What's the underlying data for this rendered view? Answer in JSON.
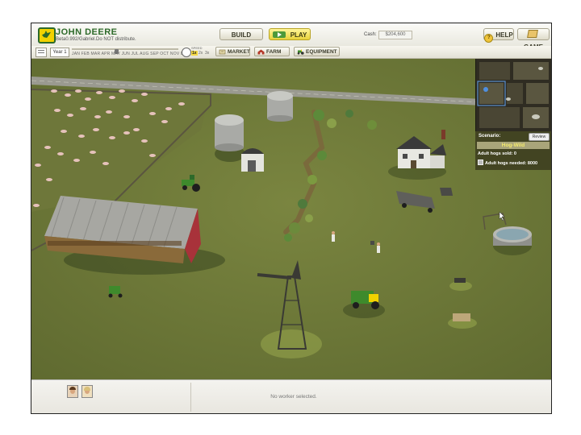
{
  "header": {
    "brand": "JOHN DEERE",
    "build_note": "Beta0.992/Gabriel.Do NOT distribute.",
    "build_label": "BUILD",
    "play_label": "PLAY",
    "cash_label": "Cash:",
    "cash_value": "$204,600",
    "help_label": "HELP",
    "game_label": "GAME"
  },
  "timebar": {
    "year_label": "Year 1",
    "months": "JAN FEB MAR APR MAY JUN JUL AUG SEP OCT NOV DEC",
    "speed_label": "SPEED",
    "speeds": [
      "1x",
      "2x",
      "3x"
    ],
    "tabs": {
      "market": "MARKET",
      "farm": "FARM",
      "equipment": "EQUIPMENT"
    }
  },
  "scenario": {
    "label": "Scenario:",
    "review_label": "Review",
    "name": "Hog-Wild",
    "hogs_sold": "Adult hogs sold: 0",
    "hogs_needed": "Adult hogs needed: 8000"
  },
  "bottom": {
    "status": "No worker selected."
  },
  "colors": {
    "grass": "#6f7a3c",
    "brand_green": "#2d6a2a",
    "brand_yellow": "#f2d200"
  },
  "icons": [
    "help-icon",
    "game-icon",
    "play-icon",
    "market-icon",
    "farm-icon",
    "equipment-icon",
    "menu-icon",
    "speed-dial-icon"
  ]
}
